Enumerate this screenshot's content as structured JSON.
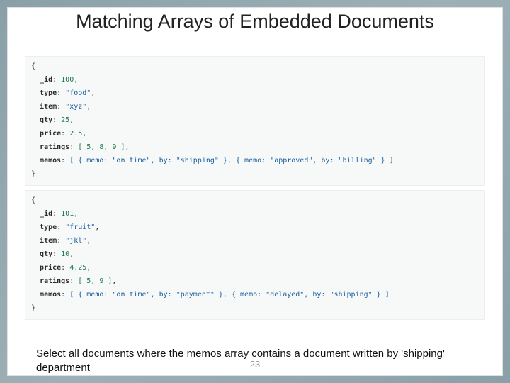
{
  "title": "Matching Arrays of Embedded Documents",
  "doc1": {
    "open": "{",
    "idKey": "_id",
    "idVal": "100",
    "typeKey": "type",
    "typeVal": "\"food\"",
    "itemKey": "item",
    "itemVal": "\"xyz\"",
    "qtyKey": "qty",
    "qtyVal": "25",
    "priceKey": "price",
    "priceVal": "2.5",
    "ratingsKey": "ratings",
    "ratingsVal": "[ 5, 8, 9 ]",
    "memosKey": "memos",
    "memosVal": "[ { memo: \"on time\", by: \"shipping\" }, { memo: \"approved\", by: \"billing\" } ]",
    "close": "}"
  },
  "doc2": {
    "open": "{",
    "idKey": "_id",
    "idVal": "101",
    "typeKey": "type",
    "typeVal": "\"fruit\"",
    "itemKey": "item",
    "itemVal": "\"jkl\"",
    "qtyKey": "qty",
    "qtyVal": "10",
    "priceKey": "price",
    "priceVal": "4.25",
    "ratingsKey": "ratings",
    "ratingsVal": "[ 5, 9 ]",
    "memosKey": "memos",
    "memosVal": "[ { memo: \"on time\", by: \"payment\" }, { memo: \"delayed\", by: \"shipping\" } ]",
    "close": "}"
  },
  "question": "Select all documents where the memos array contains a document written by 'shipping' department",
  "pageNumber": "23"
}
